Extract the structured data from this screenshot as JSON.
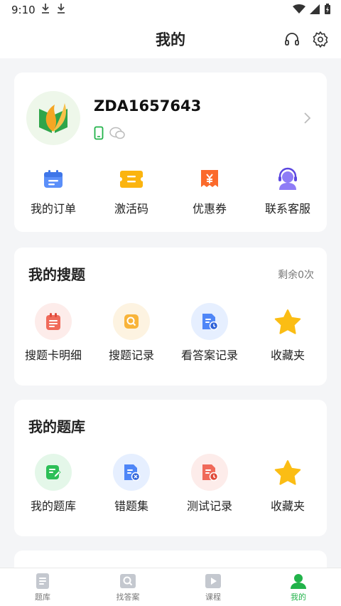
{
  "status_bar": {
    "time": "9:10"
  },
  "header": {
    "title": "我的"
  },
  "profile": {
    "user_id": "ZDA1657643"
  },
  "quick_actions": [
    {
      "label": "我的订单",
      "icon": "calendar-icon"
    },
    {
      "label": "激活码",
      "icon": "ticket-icon"
    },
    {
      "label": "优惠券",
      "icon": "coupon-icon"
    },
    {
      "label": "联系客服",
      "icon": "headset-agent-icon"
    }
  ],
  "my_search": {
    "title": "我的搜题",
    "remaining": "剩余0次",
    "items": [
      {
        "label": "搜题卡明细"
      },
      {
        "label": "搜题记录"
      },
      {
        "label": "看答案记录"
      },
      {
        "label": "收藏夹"
      }
    ]
  },
  "my_bank": {
    "title": "我的题库",
    "items": [
      {
        "label": "我的题库"
      },
      {
        "label": "错题集"
      },
      {
        "label": "测试记录"
      },
      {
        "label": "收藏夹"
      }
    ]
  },
  "tabbar": [
    {
      "label": "题库"
    },
    {
      "label": "找答案"
    },
    {
      "label": "课程"
    },
    {
      "label": "我的"
    }
  ],
  "colors": {
    "accent": "#22b34a",
    "background": "#f4f5f7"
  }
}
